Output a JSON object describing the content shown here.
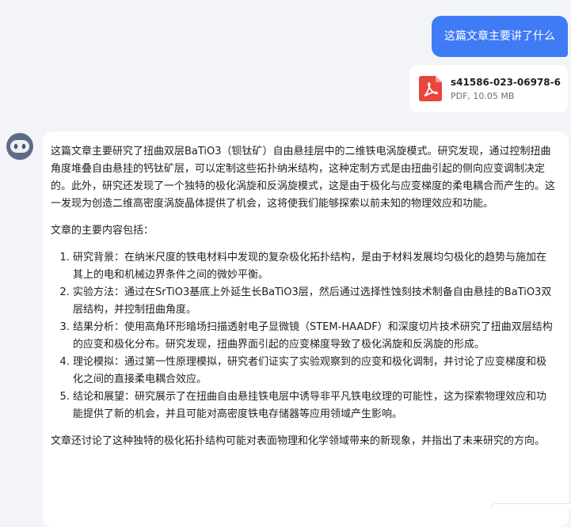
{
  "user_message": {
    "text": "这篇文章主要讲了什么"
  },
  "attachment": {
    "file_name": "s41586-023-06978-6",
    "file_meta": "PDF, 10.05 MB",
    "icon": "pdf-icon",
    "icon_color": "#e8453c"
  },
  "assistant": {
    "avatar_icon": "bot-avatar-icon",
    "summary": "这篇文章主要研究了扭曲双层BaTiO3（钡钛矿）自由悬挂层中的二维铁电涡旋模式。研究发现，通过控制扭曲角度堆叠自由悬挂的钙钛矿层，可以定制这些拓扑纳米结构，这种定制方式是由扭曲引起的侧向应变调制决定的。此外，研究还发现了一个独特的极化涡旋和反涡旋模式，这是由于极化与应变梯度的柔电耦合而产生的。这一发现为创造二维高密度涡旋晶体提供了机会，这将使我们能够探索以前未知的物理效应和功能。",
    "intro": "文章的主要内容包括：",
    "points": [
      "研究背景：在纳米尺度的铁电材料中发现的复杂极化拓扑结构，是由于材料发展均匀极化的趋势与施加在其上的电和机械边界条件之间的微妙平衡。",
      "实验方法：通过在SrTiO3基底上外延生长BaTiO3层，然后通过选择性蚀刻技术制备自由悬挂的BaTiO3双层结构，并控制扭曲角度。",
      "结果分析：使用高角环形暗场扫描透射电子显微镜（STEM-HAADF）和深度切片技术研究了扭曲双层结构的应变和极化分布。研究发现，扭曲界面引起的应变梯度导致了极化涡旋和反涡旋的形成。",
      "理论模拟：通过第一性原理模拟，研究者们证实了实验观察到的应变和极化调制，并讨论了应变梯度和极化之间的直接柔电耦合效应。",
      "结论和展望：研究展示了在扭曲自由悬挂铁电层中诱导非平凡铁电纹理的可能性，这为探索物理效应和功能提供了新的机会，并且可能对高密度铁电存储器等应用领域产生影响。"
    ],
    "conclusion": "文章还讨论了这种独特的极化拓扑结构可能对表面物理和化学领域带来的新现象，并指出了未来研究的方向。"
  },
  "colors": {
    "background": "#f3f4f8",
    "user_bubble": "#3f7bf5",
    "card": "#ffffff"
  }
}
